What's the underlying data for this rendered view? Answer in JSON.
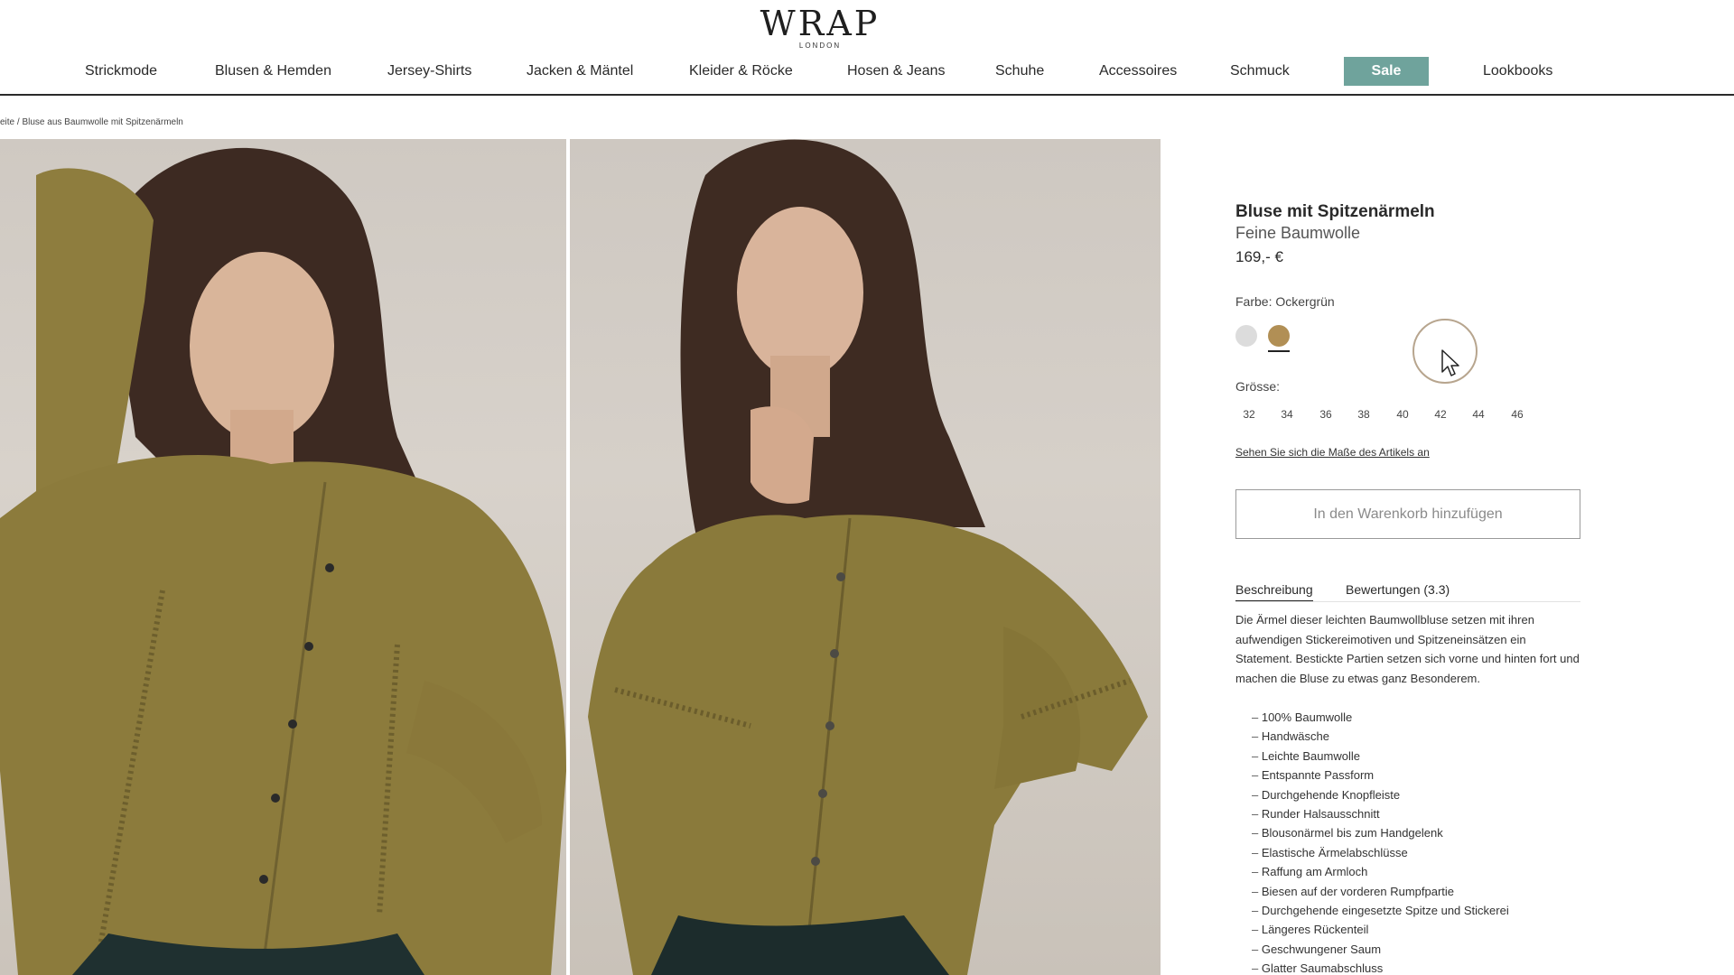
{
  "brand": {
    "name": "WRAP",
    "sub": "LONDON"
  },
  "nav": {
    "items": [
      "Strickmode",
      "Blusen & Hemden",
      "Jersey-Shirts",
      "Jacken & Mäntel",
      "Kleider & Röcke",
      "Hosen & Jeans",
      "Schuhe",
      "Accessoires",
      "Schmuck",
      "Sale",
      "Lookbooks"
    ],
    "sale_color": "#6fa39c"
  },
  "breadcrumb": "eite / Bluse aus Baumwolle mit Spitzenärmeln",
  "product": {
    "title": "Bluse mit Spitzenärmeln",
    "subtitle": "Feine Baumwolle",
    "price": "169,- €",
    "color_label": "Farbe: Ockergrün",
    "swatches": [
      "#dcdcdc",
      "#b18f55"
    ],
    "size_label": "Grösse:",
    "sizes": [
      "32",
      "34",
      "36",
      "38",
      "40",
      "42",
      "44",
      "46"
    ],
    "measure_link": "Sehen Sie sich die Maße des Artikels an",
    "cart_button": "In den Warenkorb hinzufügen"
  },
  "tabs": {
    "description": "Beschreibung",
    "reviews": "Bewertungen (3.3)"
  },
  "description": "Die Ärmel dieser leichten Baumwollbluse setzen mit ihren aufwendigen Stickereimotiven und Spitzeneinsätzen ein Statement. Bestickte Partien setzen sich vorne und hinten fort und machen die Bluse zu etwas ganz Besonderem.",
  "features": [
    "100% Baumwolle",
    "Handwäsche",
    "Leichte Baumwolle",
    "Entspannte Passform",
    "Durchgehende Knopfleiste",
    "Runder Halsausschnitt",
    "Blousonärmel bis zum Handgelenk",
    "Elastische Ärmelabschlüsse",
    "Raffung am Armloch",
    "Biesen auf der vorderen Rumpfpartie",
    "Durchgehende eingesetzte Spitze und Stickerei",
    "Längeres Rückenteil",
    "Geschwungener Saum",
    "Glatter Saumabschluss"
  ],
  "icons": {
    "cursor": "mouse-pointer-icon"
  }
}
